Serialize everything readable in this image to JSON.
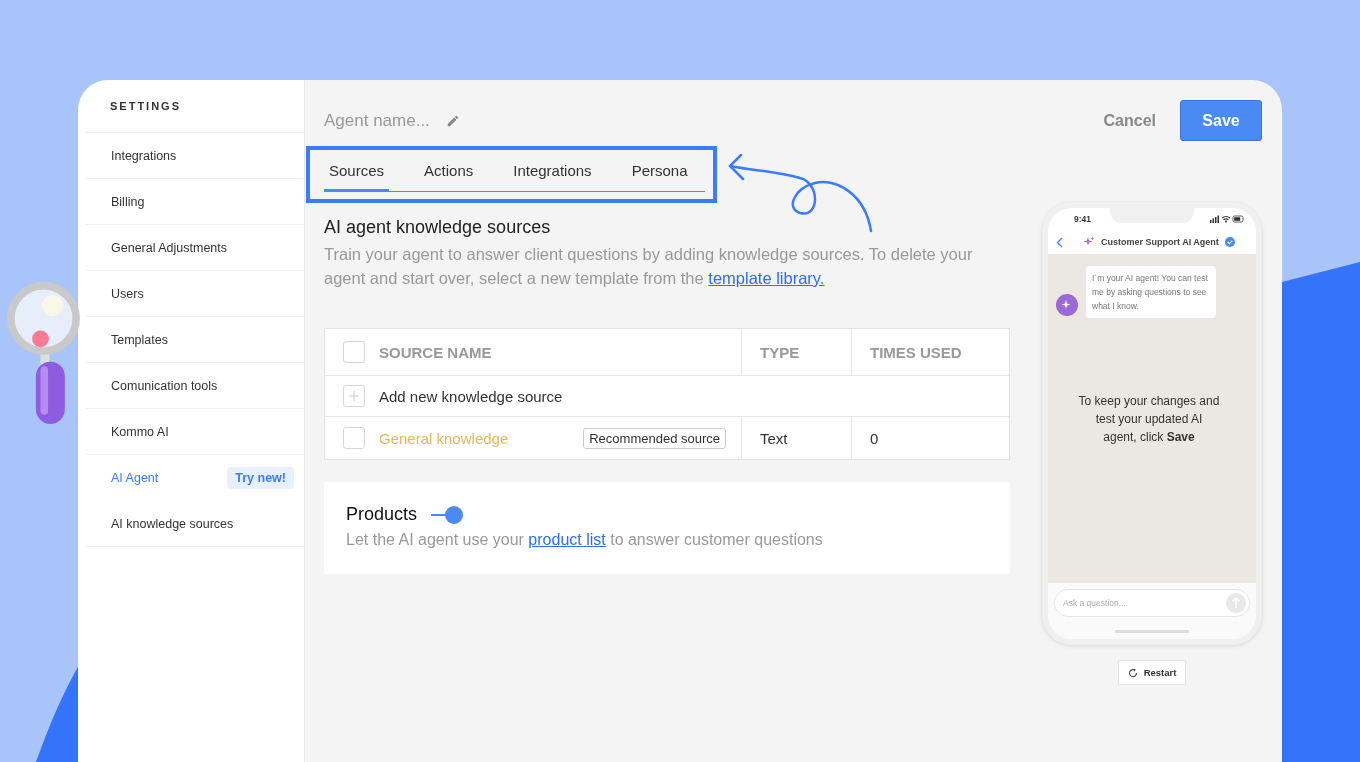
{
  "sidebar": {
    "title": "SETTINGS",
    "items": [
      {
        "label": "Integrations",
        "selected": false
      },
      {
        "label": "Billing",
        "selected": false
      },
      {
        "label": "General Adjustments",
        "selected": false
      },
      {
        "label": "Users",
        "selected": false
      },
      {
        "label": "Templates",
        "selected": false
      },
      {
        "label": "Comunication tools",
        "selected": false
      },
      {
        "label": "Kommo AI",
        "selected": false
      },
      {
        "label": "AI Agent",
        "selected": true,
        "badge": "Try new!"
      },
      {
        "label": "AI knowledge sources",
        "selected": false
      }
    ]
  },
  "header": {
    "agent_name_placeholder": "Agent name...",
    "cancel": "Cancel",
    "save": "Save"
  },
  "tabs": [
    {
      "label": "Sources",
      "selected": true
    },
    {
      "label": "Actions",
      "selected": false
    },
    {
      "label": "Integrations",
      "selected": false
    },
    {
      "label": "Persona",
      "selected": false
    }
  ],
  "knowledge": {
    "title": "AI agent knowledge sources",
    "description": "Train your agent to answer client questions by adding knowledge sources. To delete your agent and start over, select a new template from the ",
    "link": "template library."
  },
  "table": {
    "columns": [
      "SOURCE NAME",
      "TYPE",
      "TIMES USED"
    ],
    "all_checked": false,
    "add_label": "Add new knowledge source",
    "rows": [
      {
        "name": "General knowledge",
        "tag": "Recommended source",
        "type": "Text",
        "times_used": "0",
        "checked": false
      }
    ]
  },
  "products": {
    "title": "Products",
    "on": true,
    "text_before": "Let the AI agent use your ",
    "link": "product list",
    "text_after": " to answer customer questions"
  },
  "phone": {
    "time": "9:41",
    "chat_title": "Customer Support AI Agent",
    "message": "I´m your AI agent! You can test me by asking questions to see what I know.",
    "notice": "To keep your changes and test your updated AI agent, click **Save**",
    "input_placeholder": "Ask a question...",
    "restart": "Restart"
  }
}
